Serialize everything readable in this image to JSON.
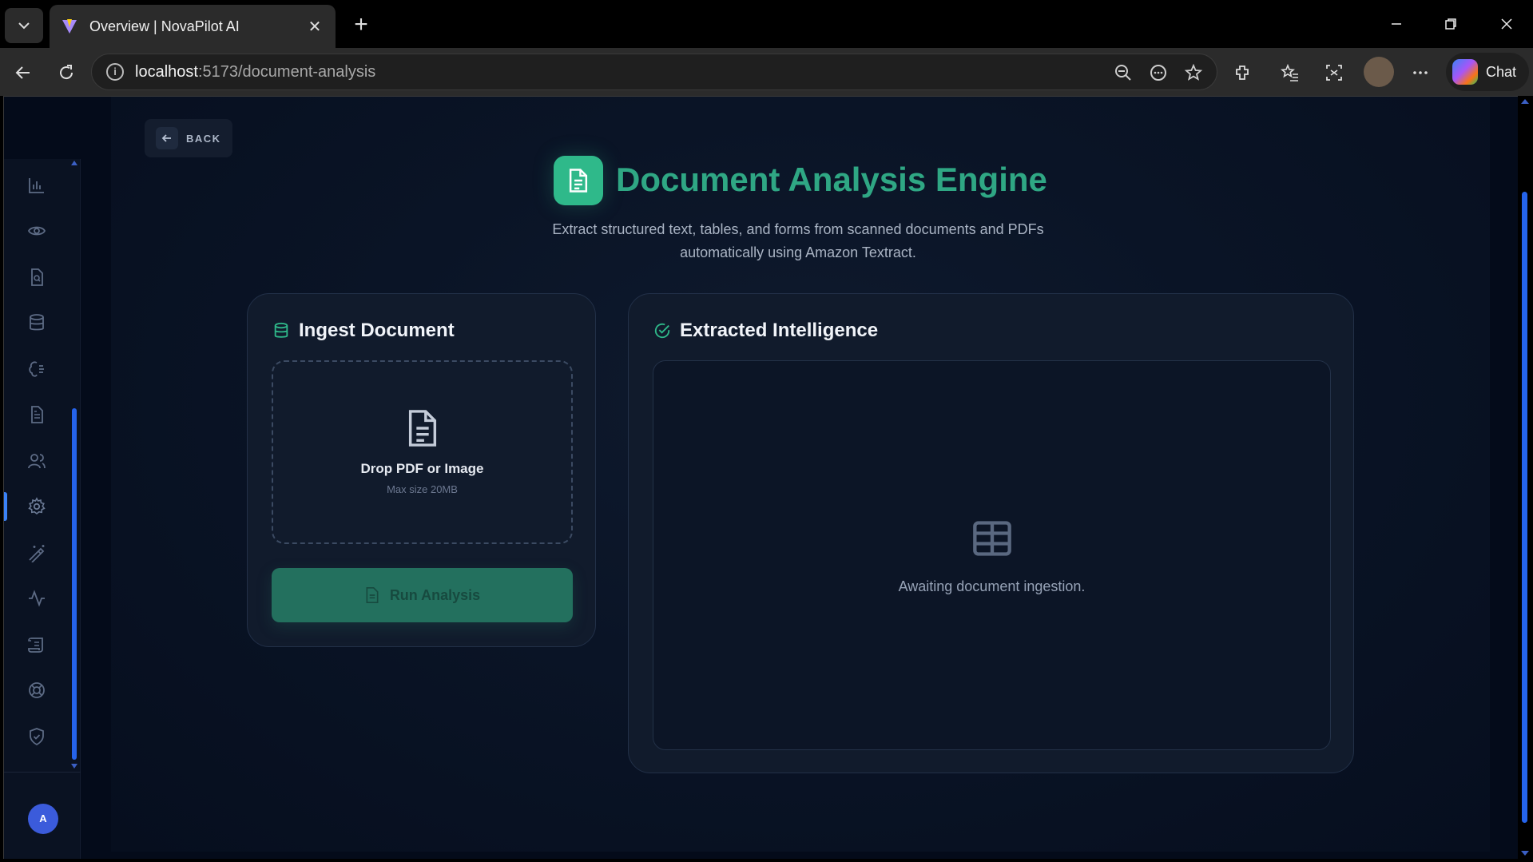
{
  "browser": {
    "tab_title": "Overview | NovaPilot AI",
    "url_host": "localhost",
    "url_path": ":5173/document-analysis",
    "chat_label": "Chat"
  },
  "sidebar": {
    "items": [
      {
        "name": "analytics-icon"
      },
      {
        "name": "eye-icon"
      },
      {
        "name": "document-search-icon"
      },
      {
        "name": "database-icon"
      },
      {
        "name": "brain-icon"
      },
      {
        "name": "document-icon"
      },
      {
        "name": "users-icon"
      },
      {
        "name": "gear-icon",
        "active": true
      },
      {
        "name": "wand-icon"
      },
      {
        "name": "activity-icon"
      },
      {
        "name": "scroll-icon"
      },
      {
        "name": "lifebuoy-icon"
      },
      {
        "name": "shield-check-icon"
      }
    ],
    "avatar_initial": "A"
  },
  "main": {
    "back_label": "BACK",
    "title": "Document Analysis Engine",
    "subtitle": "Extract structured text, tables, and forms from scanned documents and PDFs automatically using Amazon Textract.",
    "ingest": {
      "heading": "Ingest Document",
      "drop_title": "Drop PDF or Image",
      "drop_hint": "Max size 20MB",
      "run_label": "Run Analysis"
    },
    "results": {
      "heading": "Extracted Intelligence",
      "empty_message": "Awaiting document ingestion."
    }
  },
  "colors": {
    "accent": "#2fb98a",
    "background": "#040b1a",
    "card": "#111b2c",
    "scroll": "#2563eb"
  }
}
